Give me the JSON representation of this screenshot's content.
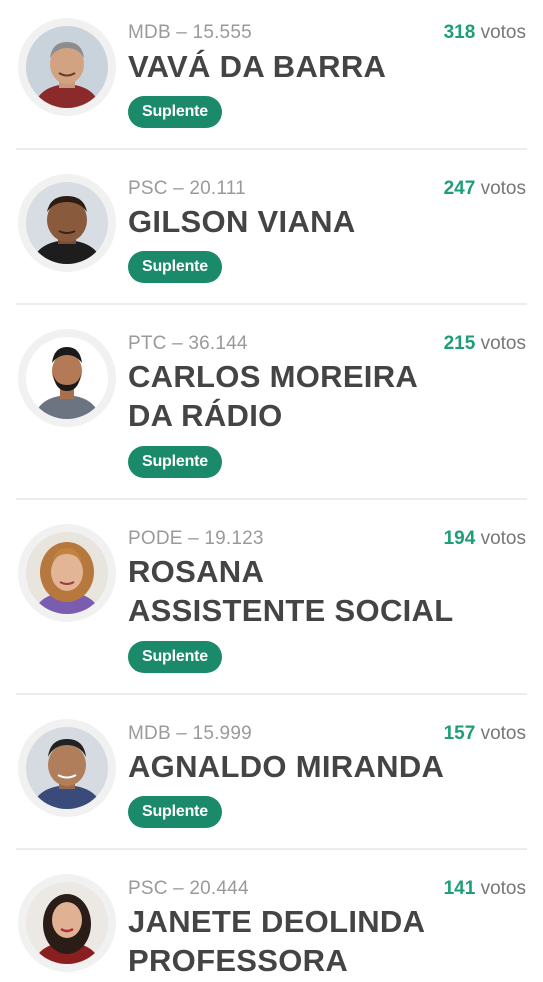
{
  "vote_unit": "votos",
  "candidates": [
    {
      "party": "MDB – 15.555",
      "name": "VAVÁ DA BARRA",
      "votes": "318",
      "status": "Suplente",
      "photo_icon": "man-gray-hair-icon"
    },
    {
      "party": "PSC – 20.111",
      "name": "GILSON VIANA",
      "votes": "247",
      "status": "Suplente",
      "photo_icon": "man-bald-icon"
    },
    {
      "party": "PTC – 36.144",
      "name": "CARLOS MOREIRA DA RÁDIO",
      "votes": "215",
      "status": "Suplente",
      "photo_icon": "man-beard-icon"
    },
    {
      "party": "PODE – 19.123",
      "name": "ROSANA ASSISTENTE SOCIAL",
      "votes": "194",
      "status": "Suplente",
      "photo_icon": "woman-curly-hair-icon"
    },
    {
      "party": "MDB – 15.999",
      "name": "AGNALDO MIRANDA",
      "votes": "157",
      "status": "Suplente",
      "photo_icon": "man-dark-hair-icon"
    },
    {
      "party": "PSC – 20.444",
      "name": "JANETE DEOLINDA PROFESSORA",
      "votes": "141",
      "status": "",
      "photo_icon": "woman-dark-hair-icon"
    }
  ],
  "colors": {
    "accent": "#1e9e78",
    "badge": "#1b8a6a",
    "name": "#444444",
    "meta": "#9a9a9a"
  }
}
